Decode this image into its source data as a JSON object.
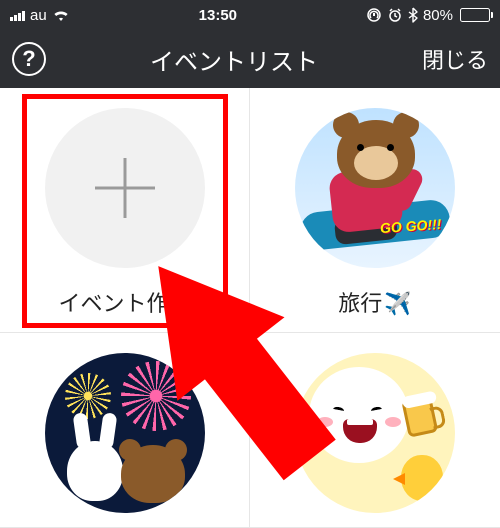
{
  "statusbar": {
    "carrier": "au",
    "time": "13:50",
    "battery_pct": "80%"
  },
  "navbar": {
    "help_label": "?",
    "title": "イベントリスト",
    "close_label": "閉じる"
  },
  "grid": {
    "items": [
      {
        "label": "イベント作成"
      },
      {
        "label": "旅行",
        "emoji": "✈️"
      },
      {
        "label": ""
      },
      {
        "label": ""
      }
    ],
    "gogo_text": "GO GO!!!"
  }
}
